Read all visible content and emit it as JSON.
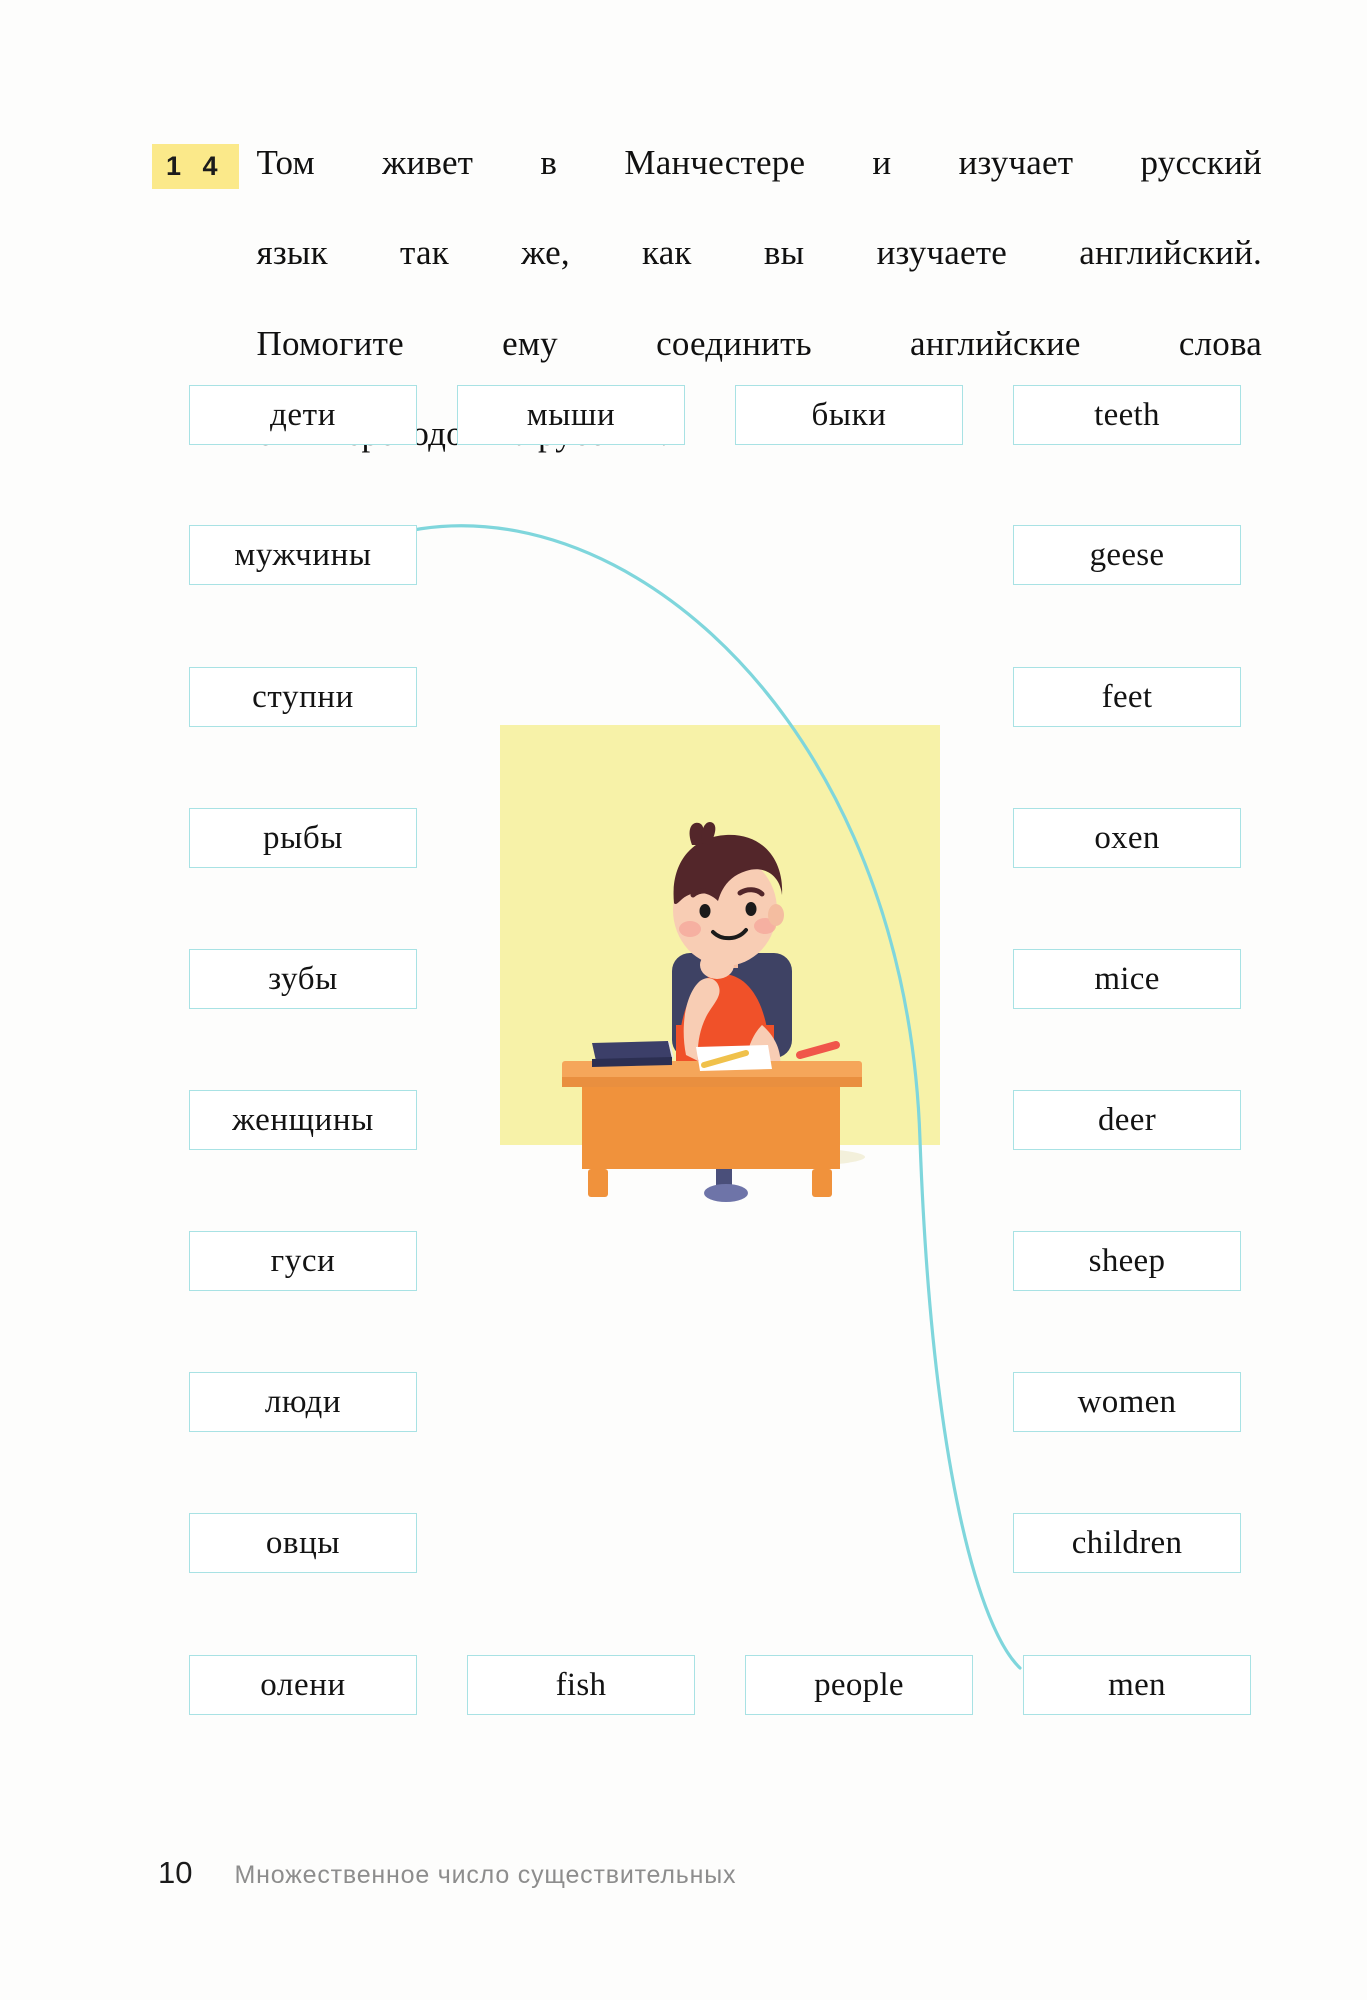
{
  "task": {
    "number": "1 4",
    "text_lines": [
      "Том живет в Манчестере и изучает русский",
      "язык так же, как вы изучаете английский.",
      "Помогите ему соединить английские слова",
      "с их переводом на русский."
    ],
    "full_text": "Том живет в Манчестере и изучает русский язык так же, как вы изучаете английский. Помогите ему соединить английские слова с их переводом на русский."
  },
  "exercise": {
    "top_row": [
      {
        "label": "дети",
        "lang": "ru"
      },
      {
        "label": "мыши",
        "lang": "ru"
      },
      {
        "label": "быки",
        "lang": "ru"
      },
      {
        "label": "teeth",
        "lang": "en"
      }
    ],
    "left_column": [
      {
        "label": "мужчины"
      },
      {
        "label": "ступни"
      },
      {
        "label": "рыбы"
      },
      {
        "label": "зубы"
      },
      {
        "label": "женщины"
      },
      {
        "label": "гуси"
      },
      {
        "label": "люди"
      },
      {
        "label": "овцы"
      }
    ],
    "right_column": [
      {
        "label": "geese"
      },
      {
        "label": "feet"
      },
      {
        "label": "oxen"
      },
      {
        "label": "mice"
      },
      {
        "label": "deer"
      },
      {
        "label": "sheep"
      },
      {
        "label": "women"
      },
      {
        "label": "children"
      }
    ],
    "bottom_row": [
      {
        "label": "олени",
        "lang": "ru"
      },
      {
        "label": "fish",
        "lang": "en"
      },
      {
        "label": "people",
        "lang": "en"
      },
      {
        "label": "men",
        "lang": "en"
      }
    ],
    "drawn_connections": [
      {
        "from": "мужчины",
        "to": "men"
      }
    ]
  },
  "footer": {
    "page_number": "10",
    "section_title": "Множественное число существительных"
  },
  "colors": {
    "box_border": "#a8e2e4",
    "connector_line": "#7fd6dc",
    "task_number_highlight": "#fbe98a",
    "illustration_background": "#f7f2a8",
    "desk": "#f0923c",
    "shirt": "#f05129",
    "hair": "#53262a",
    "chair": "#3e4264",
    "book": "#3c3f69",
    "pen": "#f0564a",
    "skin": "#f8cdb4",
    "footer_title": "#8d8d8d"
  },
  "illustration": {
    "alt": "Мальчик сидит за письменным столом с книгой, бумагой и карандашом"
  }
}
